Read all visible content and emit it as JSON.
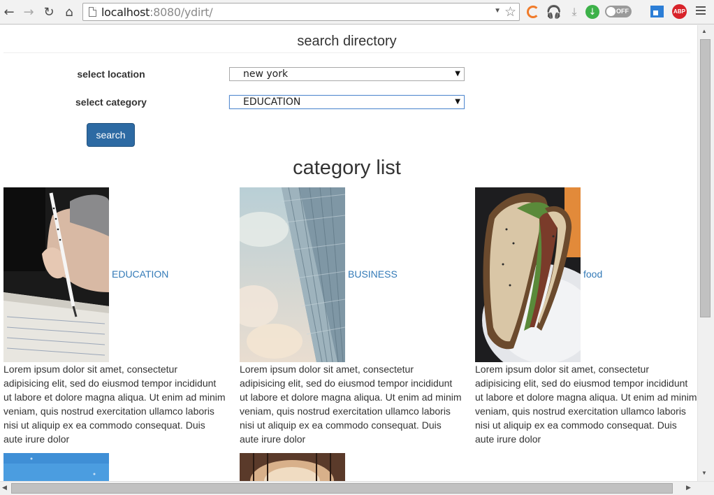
{
  "browser": {
    "url_host": "localhost",
    "url_path": ":8080/ydirt/",
    "toggle_label": "OFF",
    "abp_label": "ABP"
  },
  "page": {
    "title": "search directory",
    "location_label": "select location",
    "location_value": "new york",
    "category_label": "select category",
    "category_value": "EDUCATION",
    "search_button": "search",
    "list_heading": "category list"
  },
  "categories": [
    {
      "name": "EDUCATION",
      "image": "writing-hand-image",
      "description": "Lorem ipsum dolor sit amet, consectetur adipisicing elit, sed do eiusmod tempor incididunt ut labore et dolore magna aliqua. Ut enim ad minim veniam, quis nostrud exercitation ullamco laboris nisi ut aliquip ex ea commodo consequat. Duis aute irure dolor"
    },
    {
      "name": "BUSINESS",
      "image": "skyscraper-image",
      "description": "Lorem ipsum dolor sit amet, consectetur adipisicing elit, sed do eiusmod tempor incididunt ut labore et dolore magna aliqua. Ut enim ad minim veniam, quis nostrud exercitation ullamco laboris nisi ut aliquip ex ea commodo consequat. Duis aute irure dolor"
    },
    {
      "name": "food",
      "image": "sandwich-image",
      "description": "Lorem ipsum dolor sit amet, consectetur adipisicing elit, sed do eiusmod tempor incididunt ut labore et dolore magna aliqua. Ut enim ad minim veniam, quis nostrud exercitation ullamco laboris nisi ut aliquip ex ea commodo consequat. Duis aute irure dolor"
    }
  ],
  "colors": {
    "link": "#337ab7",
    "button": "#2d6aa3",
    "text": "#333333"
  }
}
